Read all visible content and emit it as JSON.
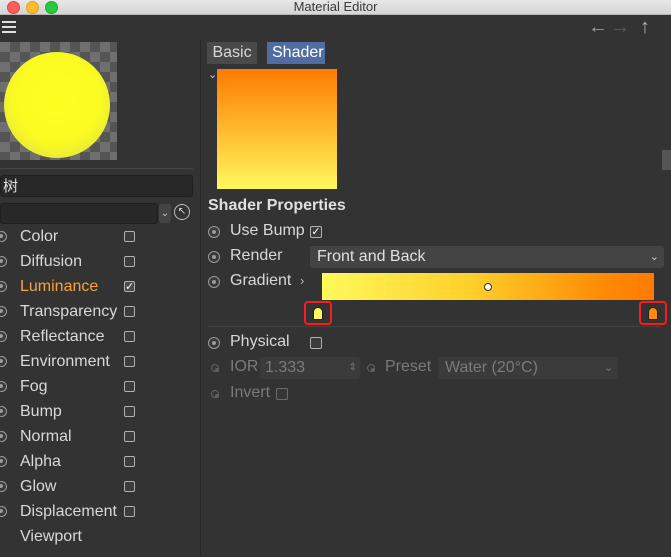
{
  "window": {
    "title": "Material Editor"
  },
  "material": {
    "name": "树"
  },
  "channels": [
    {
      "label": "Color",
      "checked": false
    },
    {
      "label": "Diffusion",
      "checked": false
    },
    {
      "label": "Luminance",
      "checked": true,
      "active": true
    },
    {
      "label": "Transparency",
      "checked": false
    },
    {
      "label": "Reflectance",
      "checked": false
    },
    {
      "label": "Environment",
      "checked": false
    },
    {
      "label": "Fog",
      "checked": false
    },
    {
      "label": "Bump",
      "checked": false
    },
    {
      "label": "Normal",
      "checked": false
    },
    {
      "label": "Alpha",
      "checked": false
    },
    {
      "label": "Glow",
      "checked": false
    },
    {
      "label": "Displacement",
      "checked": false
    },
    {
      "label": "Viewport",
      "checked": null
    }
  ],
  "tabs": {
    "basic": "Basic",
    "shader": "Shader"
  },
  "shader_properties": {
    "title": "Shader Properties",
    "use_bump": {
      "label": "Use Bump",
      "checked": true,
      "mark": "✓"
    },
    "render": {
      "label": "Render",
      "value": "Front and Back"
    },
    "gradient": {
      "label": "Gradient",
      "start_color": "#fff95c",
      "end_color": "#ff7a00",
      "knots": [
        {
          "position": 0.0,
          "color": "#fff95c"
        },
        {
          "position": 1.0,
          "color": "#ff8a05"
        }
      ],
      "midpoint": 0.5
    },
    "physical": {
      "label": "Physical",
      "checked": false
    },
    "ior": {
      "label": "IOR",
      "value": "1.333"
    },
    "preset": {
      "label": "Preset",
      "value": "Water (20°C)"
    },
    "invert": {
      "label": "Invert",
      "checked": false
    }
  },
  "colors": {
    "accent_active": "#f7a23a",
    "tab_selected": "#4f6da3",
    "highlight_frame": "#ff1a1a"
  }
}
